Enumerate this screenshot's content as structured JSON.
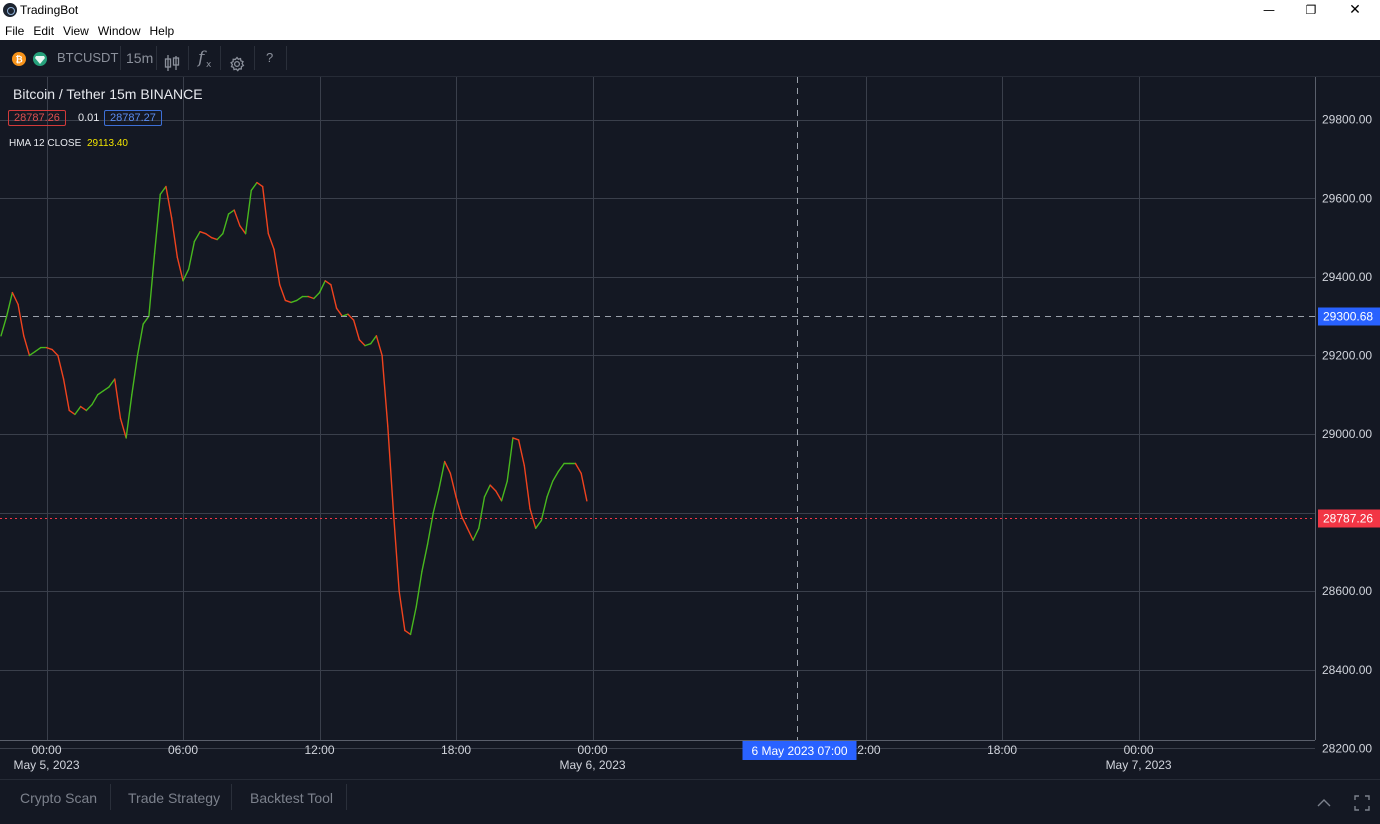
{
  "window": {
    "title": "TradingBot"
  },
  "menu": [
    "File",
    "Edit",
    "View",
    "Window",
    "Help"
  ],
  "toolbar": {
    "symbol": "BTCUSDT",
    "interval": "15m",
    "candle_icon": "candlestick-icon",
    "indicator_icon": "function-icon",
    "settings_icon": "gear-icon",
    "help_label": "?"
  },
  "legend": {
    "title": "Bitcoin / Tether 15m BINANCE",
    "bid": "28787.26",
    "spread": "0.01",
    "ask": "28787.27",
    "indicator_name": "HMA 12 CLOSE",
    "indicator_value": "29113.40"
  },
  "crosshair": {
    "time_label": "6 May 2023 07:00",
    "price_label": "29300.68"
  },
  "last_price_label": "28787.26",
  "colors": {
    "background": "#141823",
    "grid": "#3a3f4b",
    "rising": "#48b81e",
    "falling": "#f0431e",
    "crosshair_label": "#2962ff",
    "last_price": "#f23645"
  },
  "chart_data": {
    "type": "line",
    "x_unit": "15-minute bars from May 4, 2023 22:00",
    "y": [
      29250,
      29300,
      29360,
      29330,
      29250,
      29200,
      29210,
      29220,
      29220,
      29215,
      29200,
      29140,
      29060,
      29050,
      29070,
      29060,
      29075,
      29100,
      29110,
      29120,
      29140,
      29040,
      28990,
      29100,
      29200,
      29280,
      29300,
      29460,
      29610,
      29630,
      29550,
      29450,
      29390,
      29420,
      29490,
      29515,
      29510,
      29500,
      29495,
      29510,
      29560,
      29570,
      29530,
      29510,
      29620,
      29640,
      29630,
      29510,
      29470,
      29380,
      29340,
      29335,
      29340,
      29350,
      29350,
      29345,
      29360,
      29390,
      29380,
      29320,
      29300,
      29305,
      29290,
      29240,
      29225,
      29230,
      29250,
      29200,
      29020,
      28800,
      28600,
      28500,
      28490,
      28560,
      28650,
      28720,
      28800,
      28860,
      28930,
      28900,
      28840,
      28790,
      28760,
      28730,
      28760,
      28840,
      28870,
      28855,
      28830,
      28880,
      28990,
      28985,
      28920,
      28810,
      28760,
      28780,
      28840,
      28880,
      28905,
      28925,
      28925,
      28925,
      28900,
      28830
    ],
    "x_ticks": [
      {
        "label": "00:00",
        "sub": "May 5, 2023"
      },
      {
        "label": "06:00",
        "sub": ""
      },
      {
        "label": "12:00",
        "sub": ""
      },
      {
        "label": "18:00",
        "sub": ""
      },
      {
        "label": "00:00",
        "sub": "May 6, 2023"
      },
      {
        "label": "12:00",
        "sub": ""
      },
      {
        "label": "18:00",
        "sub": ""
      },
      {
        "label": "00:00",
        "sub": "May 7, 2023"
      }
    ],
    "x_tick_bars": [
      8,
      32,
      56,
      80,
      104,
      152,
      176,
      200
    ],
    "y_ticks": [
      "29800.00",
      "29600.00",
      "29400.00",
      "29200.00",
      "29000.00",
      "28600.00",
      "28400.00",
      "28200.00"
    ],
    "y_tick_values": [
      29800,
      29600,
      29400,
      29200,
      29000,
      28600,
      28400,
      28200
    ],
    "grid_values": [
      29800,
      29600,
      29400,
      29200,
      29000,
      28800,
      28600,
      28400,
      28200
    ],
    "ylim": [
      28150,
      29980
    ],
    "grid": true,
    "crosshair_value": 29300.68,
    "crosshair_bar": 140,
    "last_value": 28787.26
  },
  "bottom_tabs": [
    "Crypto Scan",
    "Trade Strategy",
    "Backtest Tool"
  ]
}
